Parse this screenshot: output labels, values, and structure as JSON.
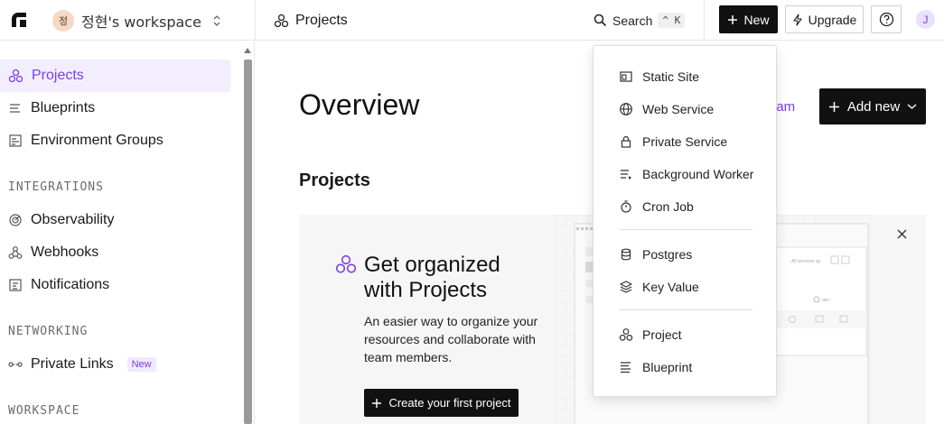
{
  "workspace": {
    "avatar_initial": "정",
    "name": "정현's workspace"
  },
  "breadcrumb": {
    "label": "Projects"
  },
  "search": {
    "label": "Search",
    "shortcut": "^ K"
  },
  "header_buttons": {
    "new": "New",
    "upgrade": "Upgrade",
    "user_initial": "J"
  },
  "sidebar": {
    "items_top": [
      {
        "label": "Projects",
        "active": true
      },
      {
        "label": "Blueprints"
      },
      {
        "label": "Environment Groups"
      }
    ],
    "integrations_heading": "INTEGRATIONS",
    "integrations": [
      {
        "label": "Observability"
      },
      {
        "label": "Webhooks"
      },
      {
        "label": "Notifications"
      }
    ],
    "networking_heading": "NETWORKING",
    "networking": [
      {
        "label": "Private Links",
        "badge": "New"
      }
    ],
    "workspace_heading": "WORKSPACE"
  },
  "main": {
    "title": "Overview",
    "team_link": "eam",
    "add_new": "Add new",
    "section_title": "Projects",
    "promo": {
      "title_line1": "Get organized",
      "title_line2": "with Projects",
      "description": "An easier way to organize your resources and collaborate with team members.",
      "cta": "Create your first project"
    }
  },
  "new_menu": {
    "services": [
      "Static Site",
      "Web Service",
      "Private Service",
      "Background Worker",
      "Cron Job"
    ],
    "datastores": [
      "Postgres",
      "Key Value"
    ],
    "other": [
      "Project",
      "Blueprint"
    ]
  },
  "colors": {
    "accent": "#7b3fe4",
    "primary_button": "#111111",
    "active_bg": "#f3eefe"
  }
}
